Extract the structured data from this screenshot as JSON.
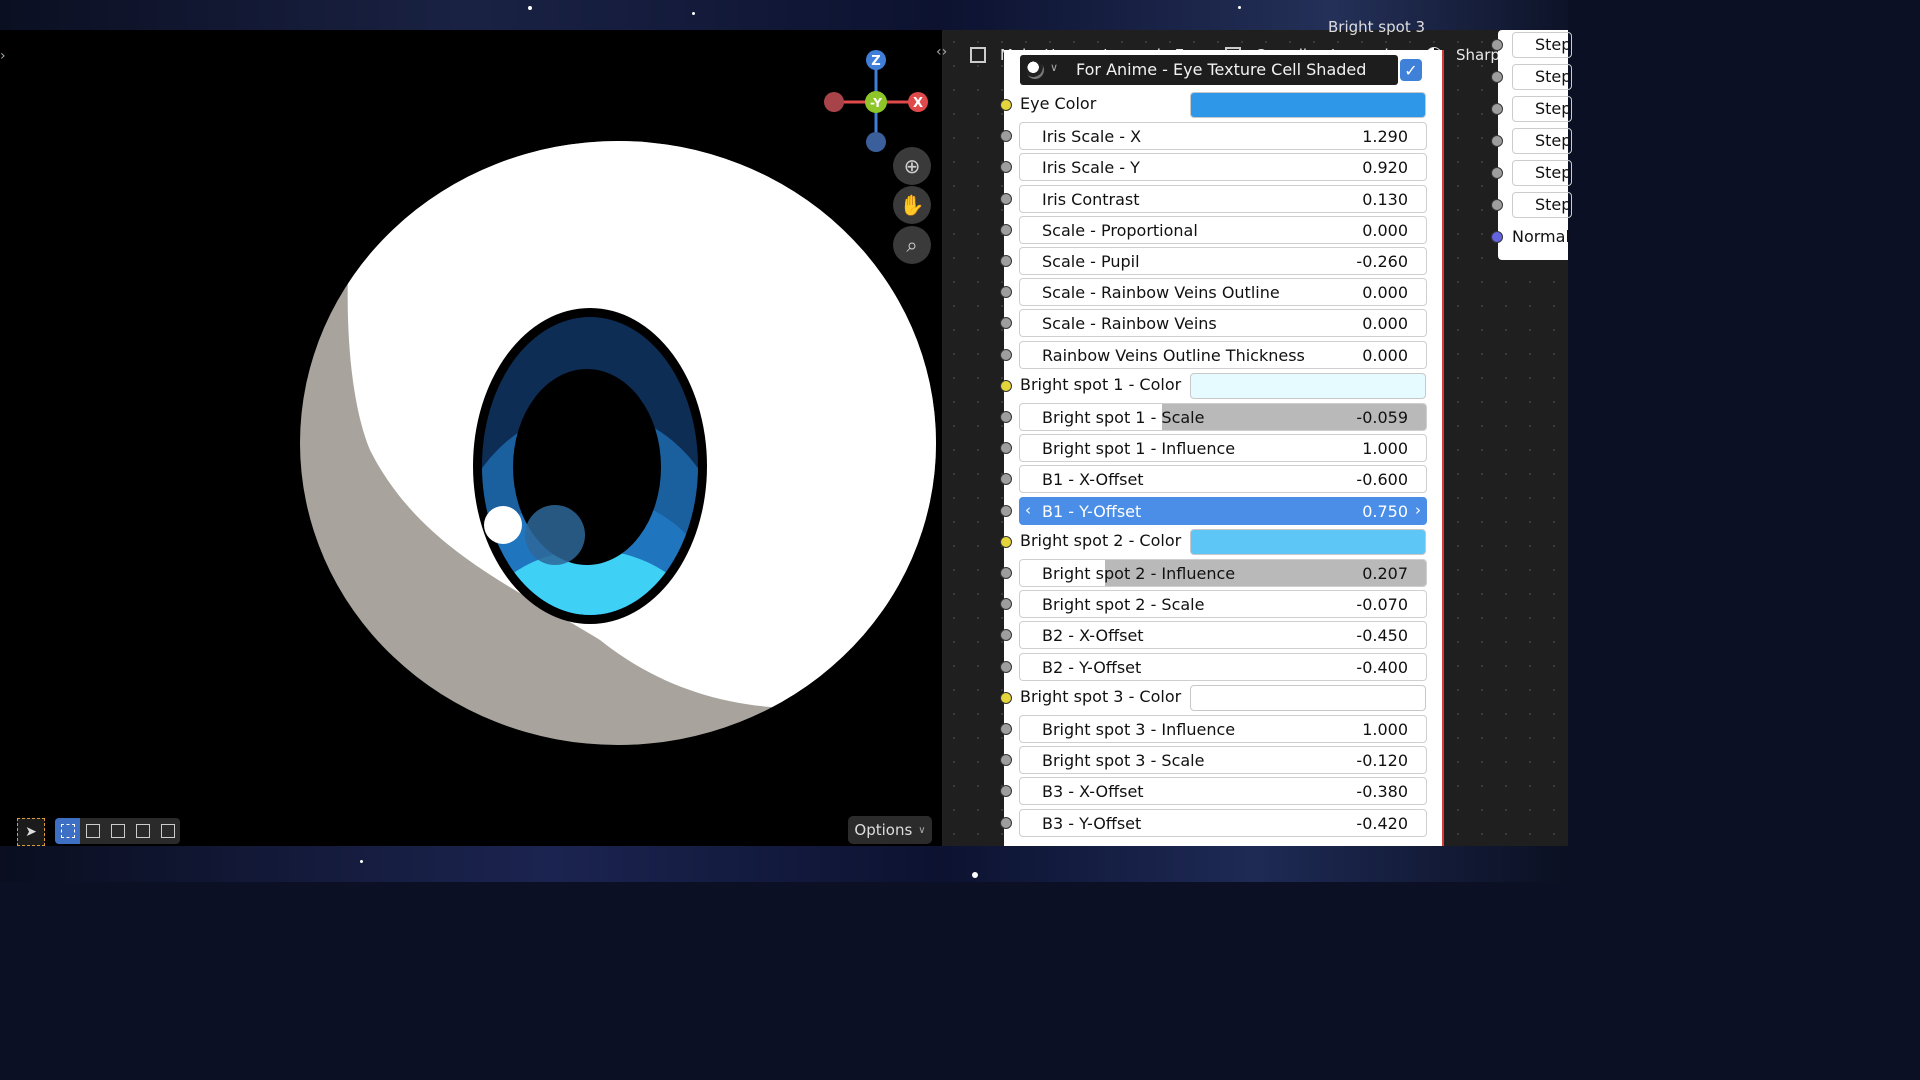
{
  "viewport": {
    "options_label": "Options",
    "gizmo": {
      "z": "Z",
      "y": "-Y",
      "x": "X"
    },
    "tools": [
      "zoom-icon",
      "hand-pan-icon",
      "camera-icon"
    ]
  },
  "header": {
    "breadcrumb_1": "Make Human Low-poly Eye",
    "breadcrumb_2": "Canadian:Low-poly",
    "top_label": "Bright spot 3",
    "sharp_eyes": "Sharp Eyes"
  },
  "node": {
    "title": "For Anime - Eye Texture Cell Shaded",
    "rows": [
      {
        "type": "color",
        "label": "Eye Color",
        "color": "#2f97e8"
      },
      {
        "type": "field",
        "label": "Iris Scale - X",
        "value": "1.290"
      },
      {
        "type": "field",
        "label": "Iris Scale - Y",
        "value": "0.920"
      },
      {
        "type": "field",
        "label": "Iris Contrast",
        "value": "0.130"
      },
      {
        "type": "field",
        "label": "Scale - Proportional",
        "value": "0.000"
      },
      {
        "type": "field",
        "label": "Scale - Pupil",
        "value": "-0.260"
      },
      {
        "type": "field",
        "label": "Scale - Rainbow Veins Outline",
        "value": "0.000"
      },
      {
        "type": "field",
        "label": "Scale - Rainbow Veins",
        "value": "0.000"
      },
      {
        "type": "field",
        "label": "Rainbow Veins Outline Thickness",
        "value": "0.000"
      },
      {
        "type": "color",
        "label": "Bright spot 1 - Color",
        "color": "#e6fbff"
      },
      {
        "type": "field",
        "label": "Bright spot 1 - Scale",
        "value": "-0.059",
        "fill": 0.65
      },
      {
        "type": "field",
        "label": "Bright spot 1 - Influence",
        "value": "1.000"
      },
      {
        "type": "field",
        "label": "B1 - X-Offset",
        "value": "-0.600"
      },
      {
        "type": "field",
        "label": "B1 - Y-Offset",
        "value": "0.750",
        "selected": true
      },
      {
        "type": "color",
        "label": "Bright spot 2 - Color",
        "color": "#5ec6f7"
      },
      {
        "type": "field",
        "label": "Bright spot 2 - Influence",
        "value": "0.207",
        "fill": 0.79
      },
      {
        "type": "field",
        "label": "Bright spot 2 - Scale",
        "value": "-0.070"
      },
      {
        "type": "field",
        "label": "B2 - X-Offset",
        "value": "-0.450"
      },
      {
        "type": "field",
        "label": "B2 - Y-Offset",
        "value": "-0.400"
      },
      {
        "type": "color",
        "label": "Bright spot 3 - Color",
        "color": "#ffffff"
      },
      {
        "type": "field",
        "label": "Bright spot 3 - Influence",
        "value": "1.000"
      },
      {
        "type": "field",
        "label": "Bright spot 3 - Scale",
        "value": "-0.120"
      },
      {
        "type": "field",
        "label": "B3 - X-Offset",
        "value": "-0.380"
      },
      {
        "type": "field",
        "label": "B3 - Y-Offset",
        "value": "-0.420"
      }
    ]
  },
  "right_node": {
    "items": [
      "Step",
      "Step",
      "Step",
      "Step",
      "Step",
      "Step"
    ],
    "normal_label": "Normal"
  }
}
